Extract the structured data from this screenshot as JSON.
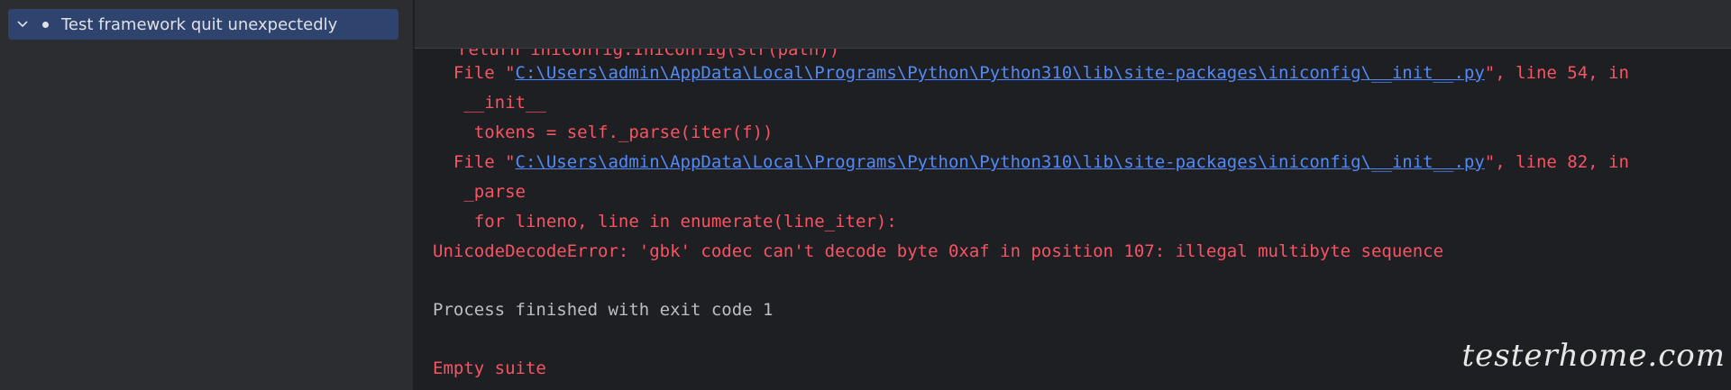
{
  "tree": {
    "items": [
      {
        "label": "Test framework quit unexpectedly"
      }
    ]
  },
  "console": {
    "clipped_top_line": "return iniconfig.IniConfig(str(path))",
    "lines": [
      {
        "prefix": "  File \"",
        "link": "C:\\Users\\admin\\AppData\\Local\\Programs\\Python\\Python310\\lib\\site-packages\\iniconfig\\__init__.py",
        "suffix": "\", line 54, in"
      },
      {
        "text": "   __init__"
      },
      {
        "text": "    tokens = self._parse(iter(f))"
      },
      {
        "prefix": "  File \"",
        "link": "C:\\Users\\admin\\AppData\\Local\\Programs\\Python\\Python310\\lib\\site-packages\\iniconfig\\__init__.py",
        "suffix": "\", line 82, in"
      },
      {
        "text": "   _parse"
      },
      {
        "text": "    for lineno, line in enumerate(line_iter):"
      },
      {
        "text": "UnicodeDecodeError: 'gbk' codec can't decode byte 0xaf in position 107: illegal multibyte sequence"
      },
      {
        "text": "Process finished with exit code 1"
      },
      {
        "text": "Empty suite"
      }
    ]
  },
  "watermark": "testerhome.com",
  "colors": {
    "error": "#f75464",
    "link": "#548af7",
    "normal": "#bcbec4",
    "selection": "#2e436e",
    "background": "#1e1f22"
  }
}
